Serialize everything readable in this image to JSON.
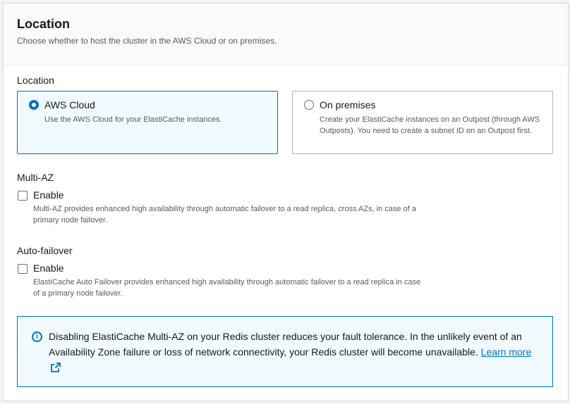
{
  "header": {
    "title": "Location",
    "description": "Choose whether to host the cluster in the AWS Cloud or on premises."
  },
  "location": {
    "label": "Location",
    "options": [
      {
        "title": "AWS Cloud",
        "description": "Use the AWS Cloud for your ElastiCache instances.",
        "selected": true
      },
      {
        "title": "On premises",
        "description": "Create your ElastiCache instances on an Outpost (through AWS Outposts). You need to create a subnet ID on an Outpost first.",
        "selected": false
      }
    ]
  },
  "multi_az": {
    "label": "Multi-AZ",
    "checkbox_label": "Enable",
    "checked": false,
    "description": "Multi-AZ provides enhanced high availability through automatic failover to a read replica, cross AZs, in case of a primary node failover."
  },
  "auto_failover": {
    "label": "Auto-failover",
    "checkbox_label": "Enable",
    "checked": false,
    "description": "ElastiCache Auto Failover provides enhanced high availability through automatic failover to a read replica in case of a primary node failover."
  },
  "alert": {
    "icon": "info-icon",
    "text": "Disabling ElastiCache Multi-AZ on your Redis cluster reduces your fault tolerance. In the unlikely event of an Availability Zone failure or loss of network connectivity, your Redis cluster will become unavailable.",
    "link_label": "Learn more"
  },
  "colors": {
    "accent": "#0073bb",
    "selected_bg": "#f1faff",
    "text": "#16191f",
    "muted": "#545b64"
  }
}
